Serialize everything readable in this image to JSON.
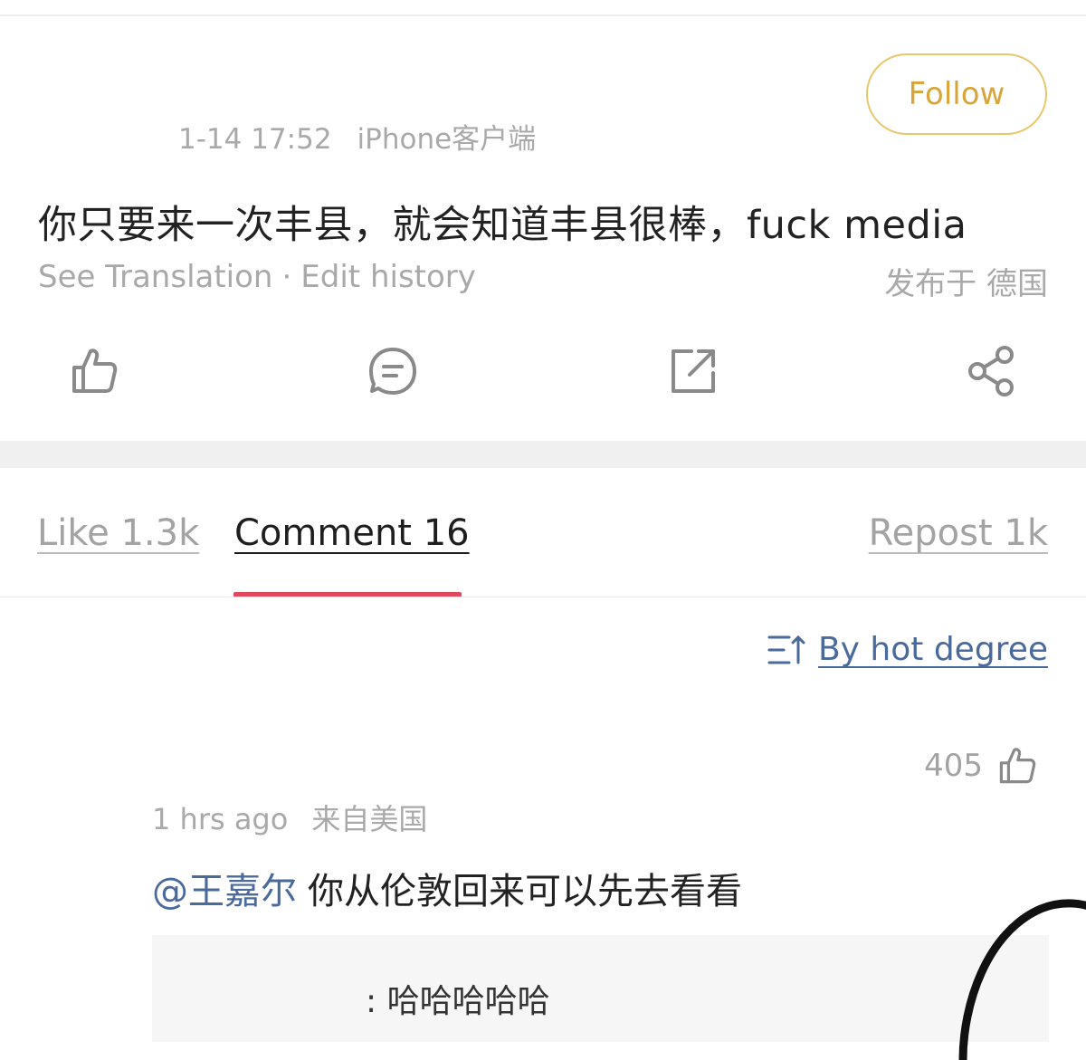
{
  "post": {
    "time": "1-14 17:52",
    "client": "iPhone客户端",
    "follow_label": "Follow",
    "text": "你只要来一次丰县，就会知道丰县很棒，fuck media",
    "see_translation": "See Translation",
    "separator": "·",
    "edit_history": "Edit history",
    "location": "发布于 德国",
    "actions": [
      {
        "icon": "thumbs-up-icon"
      },
      {
        "icon": "comment-icon"
      },
      {
        "icon": "repost-icon"
      },
      {
        "icon": "share-icon"
      }
    ]
  },
  "tabs": {
    "like": "Like 1.3k",
    "comment": "Comment 16",
    "repost": "Repost 1k",
    "active": "comment"
  },
  "sort": {
    "label": "By hot degree",
    "icon": "sort-icon"
  },
  "comment": {
    "likes": "405",
    "time": "1 hrs ago",
    "location": "来自美国",
    "mention": "@王嘉尔",
    "text": "你从伦敦回来可以先去看看",
    "reply": ": 哈哈哈哈哈"
  },
  "colors": {
    "follow": "#d9a53a",
    "tab_indicator": "#e0485e",
    "link": "#4a6a9c",
    "muted_text": "#a9a9a9"
  }
}
